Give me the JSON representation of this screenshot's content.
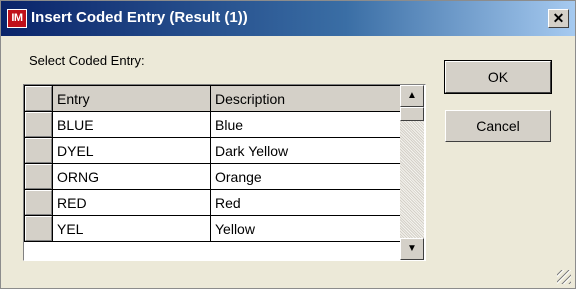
{
  "window": {
    "title": "Insert Coded Entry (Result (1))",
    "app_icon_text": "IM",
    "close_symbol": "✕"
  },
  "select_label": "Select Coded Entry:",
  "table": {
    "columns": [
      "Entry",
      "Description"
    ],
    "rows": [
      {
        "entry": "BLUE",
        "description": "Blue"
      },
      {
        "entry": "DYEL",
        "description": "Dark Yellow"
      },
      {
        "entry": "ORNG",
        "description": "Orange"
      },
      {
        "entry": "RED",
        "description": "Red"
      },
      {
        "entry": "YEL",
        "description": "Yellow"
      }
    ]
  },
  "scrollbar": {
    "up_symbol": "▲",
    "down_symbol": "▼"
  },
  "buttons": {
    "ok": "OK",
    "cancel": "Cancel"
  },
  "colors": {
    "title_start": "#0a246a",
    "title_end": "#a6caf0",
    "face": "#d4d0c8",
    "dialog_bg": "#ece9d8"
  }
}
